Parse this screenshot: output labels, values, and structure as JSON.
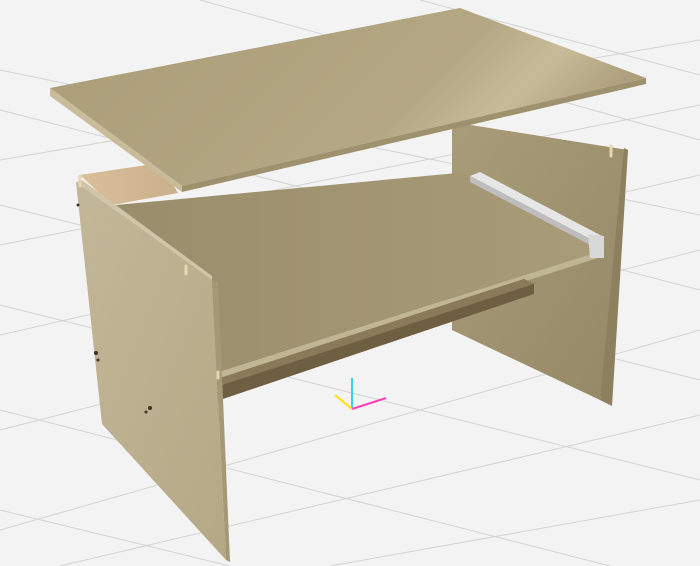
{
  "viewport": {
    "type": "3d-model-viewer",
    "background": "#f3f3f3",
    "grid_color": "#d4d4d4",
    "grid_visible": true,
    "model": {
      "object": "desk-assembly-exploded",
      "parts": [
        "desk-top-panel",
        "left-side-panel",
        "right-side-panel",
        "middle-shelf",
        "back-rail",
        "back-panel",
        "drawer-slide-rail",
        "wooden-dowels"
      ],
      "material_color": "#bdb190"
    },
    "axis_gizmo": {
      "x_color": "#ff3fb7",
      "y_color": "#ffe000",
      "z_color": "#33d3f0"
    }
  }
}
